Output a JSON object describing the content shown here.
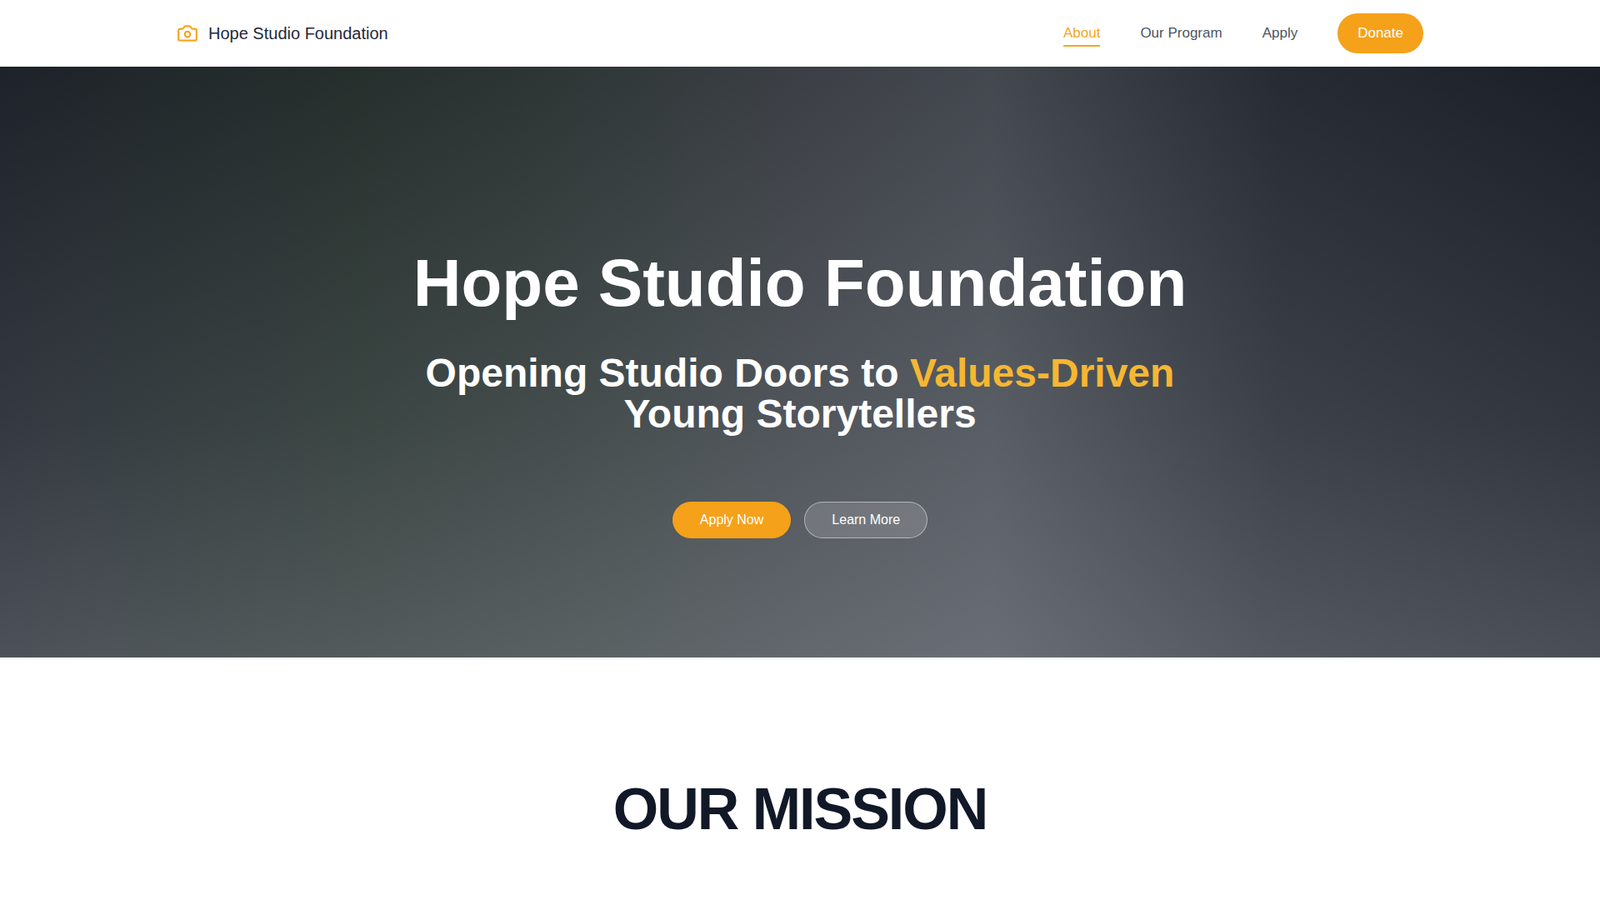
{
  "nav": {
    "brand": "Hope Studio Foundation",
    "links": [
      {
        "label": "About",
        "selected": true
      },
      {
        "label": "Our Program",
        "selected": false
      },
      {
        "label": "Apply",
        "selected": false
      }
    ],
    "donate": "Donate"
  },
  "hero": {
    "title": "Hope Studio Foundation",
    "subtitle_lead": "Opening Studio Doors to ",
    "subtitle_highlight": "Values-Driven",
    "subtitle_tail": "Young Storytellers",
    "buttons": [
      {
        "label": "Apply Now",
        "kind": "primary"
      },
      {
        "label": "Learn More",
        "kind": "secondary"
      }
    ]
  },
  "mission": {
    "title": "OUR MISSION"
  }
}
